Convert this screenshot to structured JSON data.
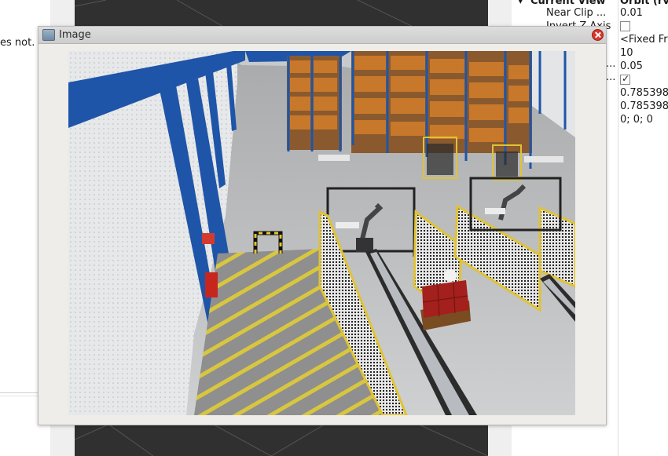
{
  "left_panel": {
    "text": "es not."
  },
  "properties": {
    "header_name": "Current View",
    "header_value": "Orbit (rv",
    "rows": [
      {
        "label": "Near Clip ...",
        "value": "0.01"
      },
      {
        "label": "Invert Z Axis",
        "value": ""
      },
      {
        "label": "",
        "value": "<Fixed Fr"
      },
      {
        "label": "",
        "value": "10"
      },
      {
        "label": "...",
        "value": "0.05"
      },
      {
        "label": "...",
        "value": ""
      },
      {
        "label": "",
        "value": "0.785398"
      },
      {
        "label": "",
        "value": "0.785398"
      },
      {
        "label": "",
        "value": "0; 0; 0"
      }
    ]
  },
  "image_window": {
    "title": "Image",
    "icon": "image-icon",
    "close_icon": "close-icon",
    "content": "warehouse-camera-view"
  },
  "colors": {
    "steel_blue": "#1f55a8",
    "safety_yellow": "#d9c23a",
    "rack_orange": "#c8782a",
    "close_red": "#d9362b"
  }
}
